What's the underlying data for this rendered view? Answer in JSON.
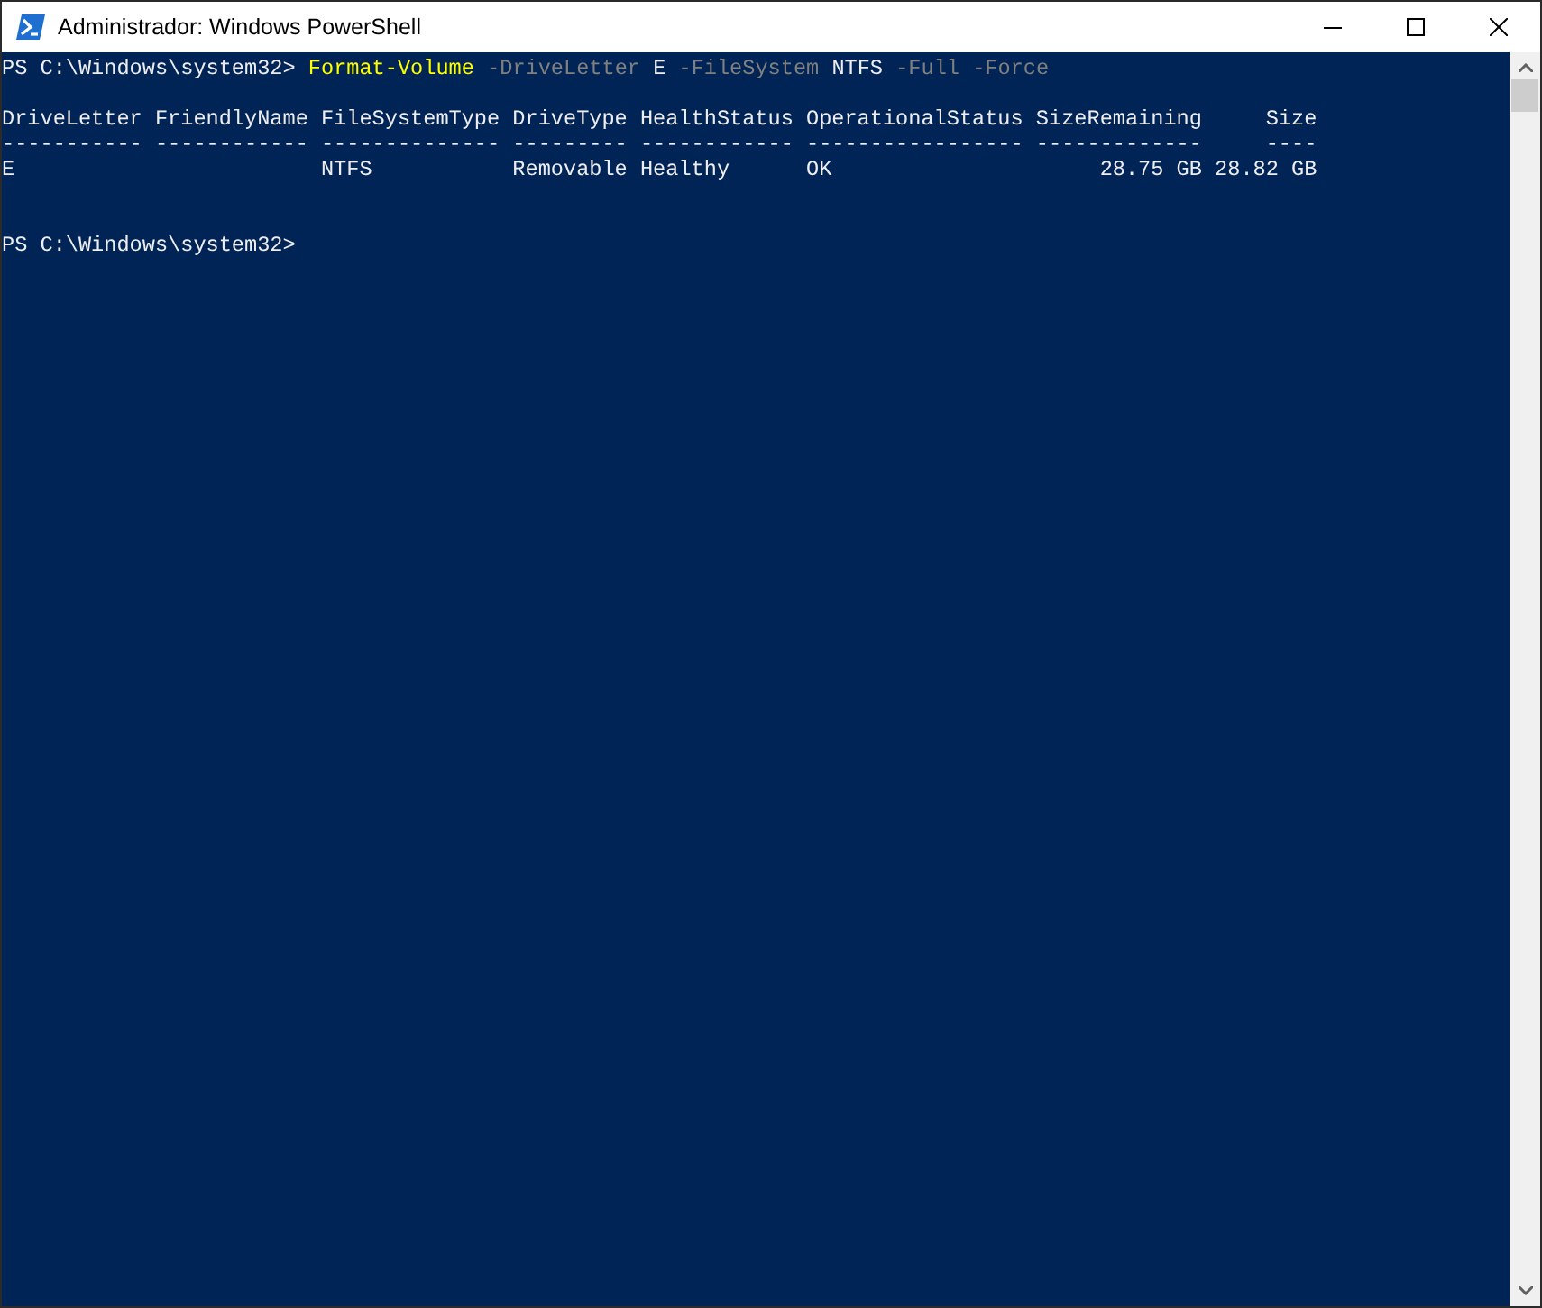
{
  "window": {
    "title": "Administrador: Windows PowerShell"
  },
  "console": [
    {
      "kind": "command",
      "segments": [
        {
          "kind": "prompt",
          "text": "PS C:\\Windows\\system32>"
        },
        {
          "kind": "cmdlet",
          "text": "Format-Volume"
        },
        {
          "kind": "param",
          "text": "-DriveLetter"
        },
        {
          "kind": "arg",
          "text": "E"
        },
        {
          "kind": "param",
          "text": "-FileSystem"
        },
        {
          "kind": "arg",
          "text": "NTFS"
        },
        {
          "kind": "param",
          "text": "-Full"
        },
        {
          "kind": "param",
          "text": "-Force"
        }
      ]
    },
    {
      "kind": "table",
      "lines": [
        "DriveLetter FriendlyName FileSystemType DriveType HealthStatus OperationalStatus SizeRemaining     Size",
        "----------- ------------ -------------- --------- ------------ ----------------- -------------     ----",
        "E                        NTFS           Removable Healthy      OK                     28.75 GB 28.82 GB"
      ]
    },
    {
      "kind": "command",
      "segments": [
        {
          "kind": "prompt",
          "text": "PS C:\\Windows\\system32>"
        }
      ]
    }
  ]
}
